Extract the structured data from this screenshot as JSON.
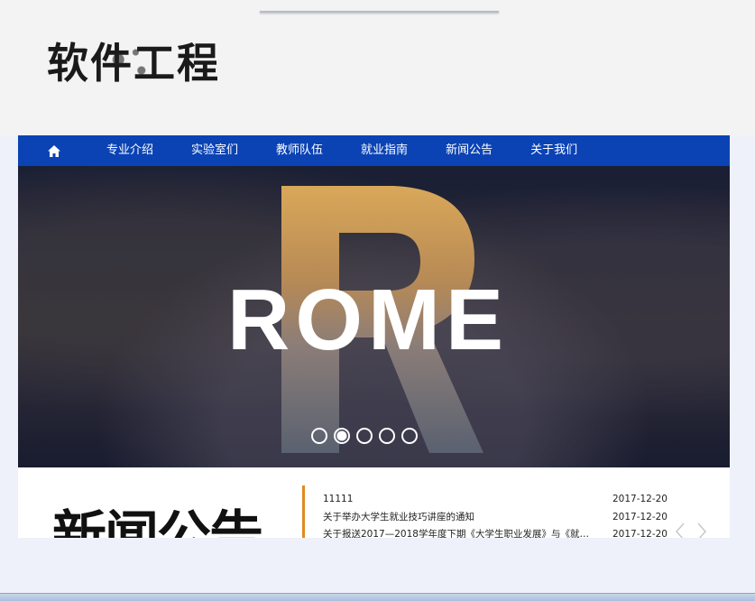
{
  "logo": {
    "text": "软件工程"
  },
  "nav": {
    "home_icon": "home-icon",
    "items": [
      "专业介绍",
      "实验室们",
      "教师队伍",
      "就业指南",
      "新闻公告",
      "关于我们"
    ]
  },
  "banner": {
    "headline": "ROME",
    "slide_count": 5,
    "active_slide": 2
  },
  "news": {
    "title": "新闻公告",
    "items": [
      {
        "title": "11111",
        "date": "2017-12-20"
      },
      {
        "title": "关于举办大学生就业技巧讲座的通知",
        "date": "2017-12-20"
      },
      {
        "title": "关于报送2017—2018学年度下期《大学生职业发展》与《就业…",
        "date": "2017-12-20"
      }
    ]
  },
  "colors": {
    "nav_bg": "#0b43b5",
    "accent": "#e08a1e"
  }
}
